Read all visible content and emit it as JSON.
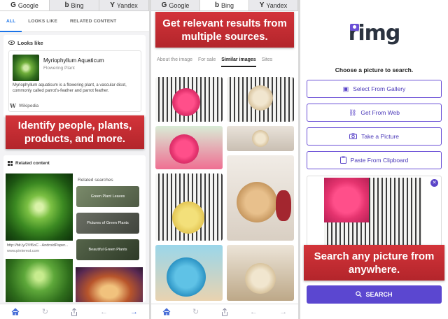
{
  "engine_tabs": [
    "Google",
    "Bing",
    "Yandex"
  ],
  "panel1": {
    "sub_tabs": [
      "ALL",
      "LOOKS LIKE",
      "RELATED CONTENT"
    ],
    "looks_like": {
      "heading": "Looks like",
      "name": "Myriophyllum Aquaticum",
      "type": "Flowering Plant",
      "description": "Myriophyllum aquaticum is a flowering plant, a vascular dicot, commonly called parrot's-feather and parrot feather.",
      "source": "Wikipedia"
    },
    "banner": "Identify people, plants, products, and more.",
    "related": {
      "heading": "Related content",
      "caption": "http://bit.ly/2Vf6oC - AndroidPaper...",
      "source": "www.pinterest.com",
      "searches_title": "Related searches",
      "searches": [
        "Green Plant Leaves",
        "Pictures of Green Plants",
        "Beautiful Green Plants"
      ]
    }
  },
  "panel2": {
    "banner": "Get relevant results from multiple sources.",
    "tabs": [
      "About the image",
      "For sale",
      "Similar images",
      "Sites"
    ]
  },
  "panel3": {
    "logo": "rimg",
    "choose": "Choose a picture to search.",
    "options": [
      {
        "label": "Select From Gallery",
        "icon": "gallery-icon"
      },
      {
        "label": "Get From Web",
        "icon": "link-icon"
      },
      {
        "label": "Take a Picture",
        "icon": "camera-icon"
      },
      {
        "label": "Paste From Clipboard",
        "icon": "clipboard-icon"
      }
    ],
    "banner": "Search any picture from anywhere.",
    "search_button": "SEARCH"
  },
  "colors": {
    "accent": "#5b47d0",
    "banner": "#c62d33",
    "link": "#1a73e8"
  }
}
